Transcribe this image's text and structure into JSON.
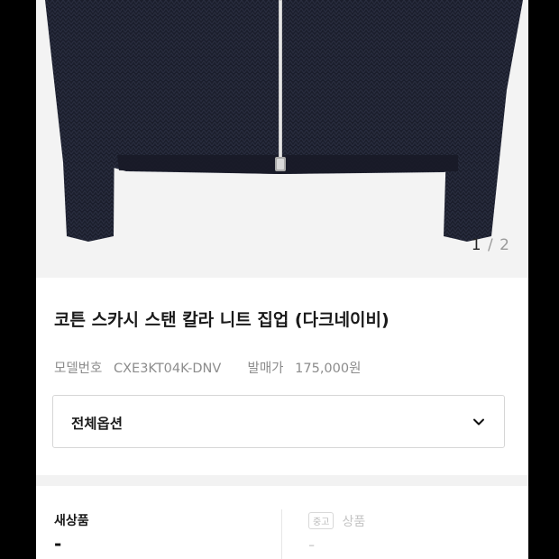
{
  "gallery": {
    "image_alt": "navy knit zip-up jacket",
    "current": "1",
    "separator": "/",
    "total": "2"
  },
  "product": {
    "title": "코튼 스카시 스탠 칼라 니트 집업 (다크네이비)",
    "model_label": "모델번호",
    "model_value": "CXE3KT04K-DNV",
    "price_label": "발매가",
    "price_value": "175,000원"
  },
  "options": {
    "label": "전체옵션",
    "icon": "chevron-down-icon"
  },
  "condition": {
    "new_label": "새상품",
    "new_value": "-",
    "used_badge": "중고",
    "used_label": "상품",
    "used_value": "-"
  },
  "colors": {
    "garment": "#1b1e2c",
    "zipper": "#c9c9c9",
    "background": "#f3f3f3",
    "divider": "#f2f2f2"
  }
}
